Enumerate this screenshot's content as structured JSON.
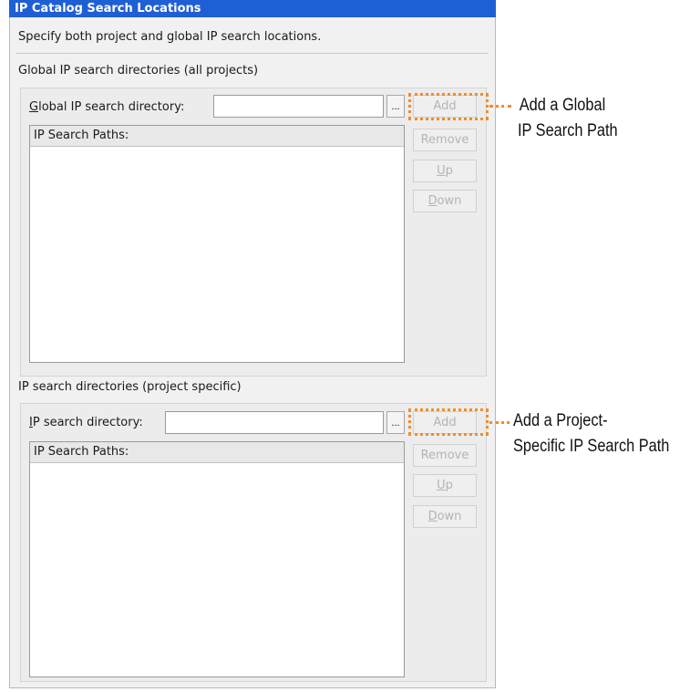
{
  "dialog": {
    "title": "IP Catalog Search Locations",
    "description": "Specify both project and global IP search locations."
  },
  "global_section": {
    "heading": "Global IP search directories (all projects)",
    "field_label_mnemonic": "G",
    "field_label_rest": "lobal IP search directory:",
    "input_value": "",
    "browse_label": "...",
    "list_header": "IP Search Paths:",
    "paths": [],
    "buttons": {
      "add": "Add",
      "remove": "Remove",
      "up": "Up",
      "down": "Down"
    }
  },
  "project_section": {
    "heading": "IP search directories (project specific)",
    "field_label_mnemonic": "I",
    "field_label_rest": "P search directory:",
    "input_value": "",
    "browse_label": "...",
    "list_header": "IP Search Paths:",
    "paths": [],
    "buttons": {
      "add": "Add",
      "remove": "Remove",
      "up": "Up",
      "down": "Down"
    }
  },
  "callouts": {
    "global": {
      "line1": "Add a Global",
      "line2": "IP Search Path"
    },
    "project": {
      "line1": "Add a Project-",
      "line2": "Specific IP Search Path"
    }
  },
  "colors": {
    "titlebar": "#1f5fd6",
    "callout": "#f08c2c",
    "disabled_text": "#b4b4b4"
  }
}
